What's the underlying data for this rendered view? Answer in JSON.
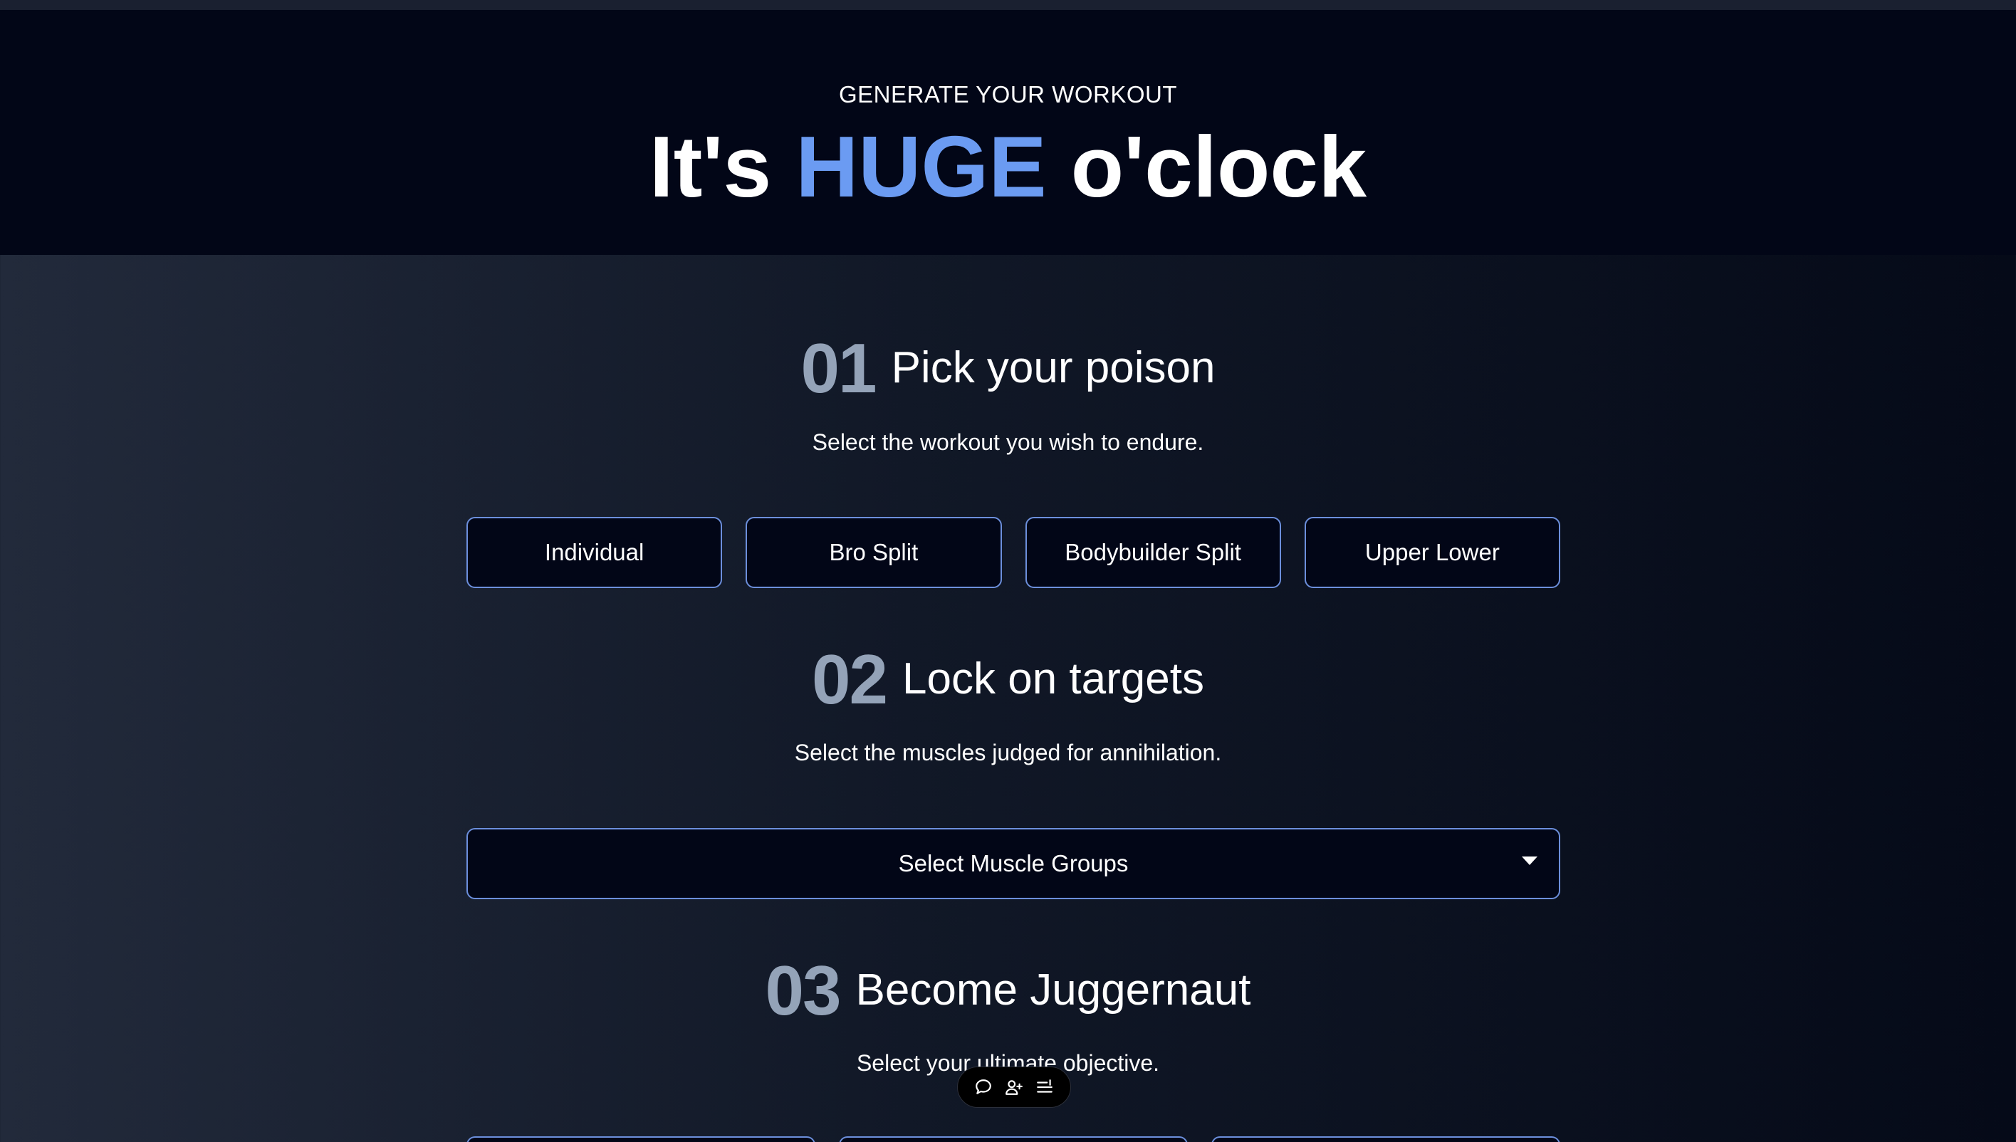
{
  "hero": {
    "eyebrow": "GENERATE YOUR WORKOUT",
    "title_prefix": "It's",
    "title_accent": "HUGE",
    "title_suffix": "o'clock"
  },
  "sections": [
    {
      "number": "01",
      "title": "Pick your poison",
      "subtitle": "Select the workout you wish to endure."
    },
    {
      "number": "02",
      "title": "Lock on targets",
      "subtitle": "Select the muscles judged for annihilation."
    },
    {
      "number": "03",
      "title": "Become Juggernaut",
      "subtitle": "Select your ultimate objective."
    }
  ],
  "workout_options": [
    "Individual",
    "Bro Split",
    "Bodybuilder Split",
    "Upper Lower"
  ],
  "muscle_select": {
    "placeholder": "Select Muscle Groups",
    "icon": "chevron-down-icon"
  },
  "toolbar": {
    "icons": [
      "comment-icon",
      "add-user-icon",
      "list-settings-icon"
    ]
  },
  "colors": {
    "accent": "#6b9bf2",
    "button_border": "#6c8fdc",
    "number": "#94a3b8",
    "hero_bg": "#020617"
  }
}
